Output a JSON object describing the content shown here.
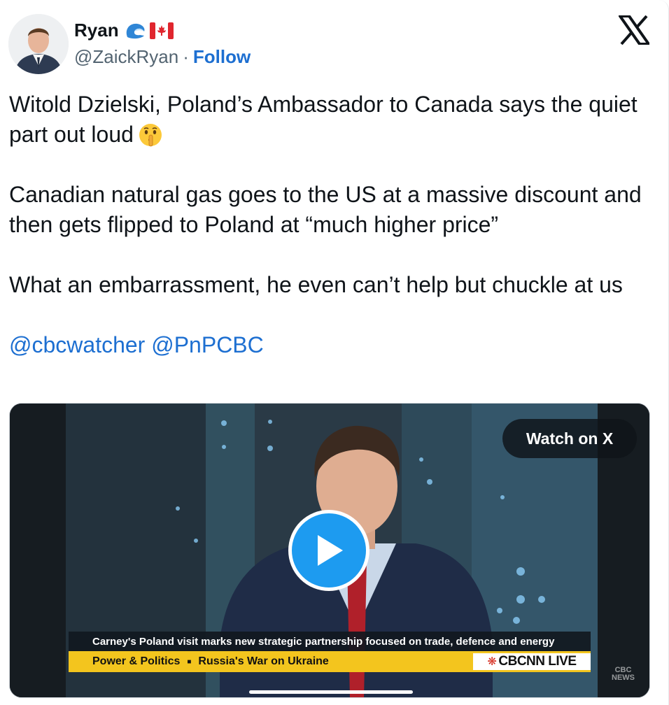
{
  "author": {
    "name": "Ryan",
    "handle": "@ZaickRyan",
    "separator": "·",
    "follow_label": "Follow",
    "badges": [
      "wave-icon",
      "canada-flag-icon"
    ]
  },
  "tweet": {
    "line1": "Witold Dzielski, Poland’s Ambassador to Canada says the quiet part out loud",
    "line1_emoji": "shushing-face-emoji",
    "paragraph2": "Canadian natural gas goes to the US at a massive discount and then gets flipped to Poland at “much higher price”",
    "paragraph3": "What an embarrassment, he even can’t help but chuckle at us",
    "mentions": [
      "@cbcwatcher",
      "@PnPCBC"
    ]
  },
  "media": {
    "watch_label": "Watch on X",
    "lower_third": "Carney's Poland visit marks new strategic partnership focused on trade, defence and energy",
    "ticker_left": "Power & Politics",
    "ticker_sep": "■",
    "ticker_right": "Russia's War on Ukraine",
    "network_badge": "CBCNN LIVE",
    "corner_logo_top": "CBC",
    "corner_logo_bottom": "NEWS"
  },
  "colors": {
    "link": "#1d6fd1",
    "play_button": "#1d9bf0",
    "ticker": "#f3c51e"
  }
}
